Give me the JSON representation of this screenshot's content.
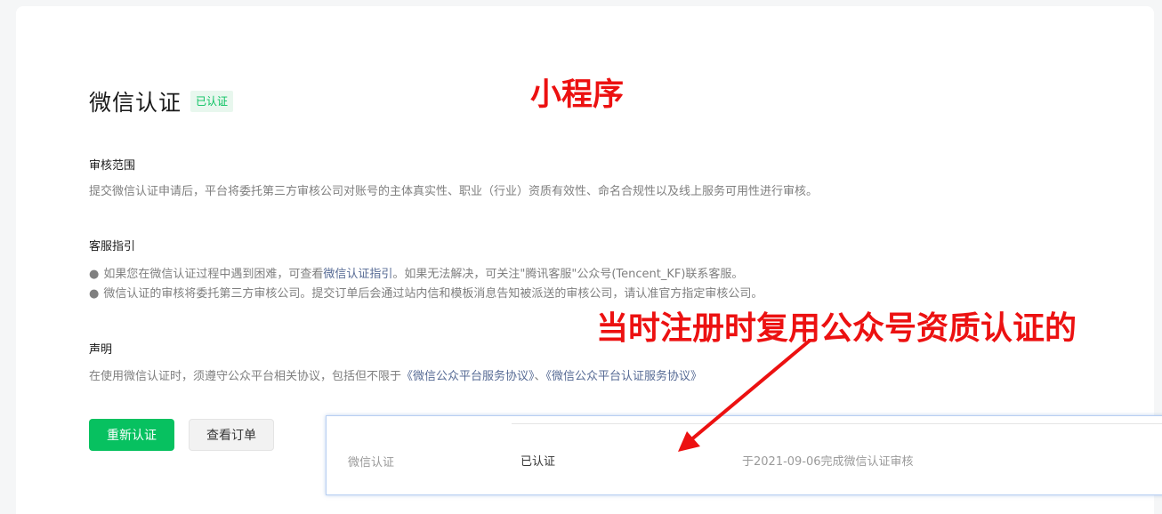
{
  "page": {
    "title": "微信认证",
    "status_badge": "已认证"
  },
  "annotations": {
    "top_label": "小程序",
    "note": "当时注册时复用公众号资质认证的",
    "color": "#ec1111"
  },
  "sections": {
    "scope": {
      "title": "审核范围",
      "text": "提交微信认证申请后，平台将委托第三方审核公司对账号的主体真实性、职业（行业）资质有效性、命名合规性以及线上服务可用性进行审核。"
    },
    "support": {
      "title": "客服指引",
      "line1_prefix": "如果您在微信认证过程中遇到困难，可查看",
      "line1_link": "微信认证指引",
      "line1_suffix": "。如果无法解决，可关注\"腾讯客服\"公众号(Tencent_KF)联系客服。",
      "line2": "微信认证的审核将委托第三方审核公司。提交订单后会通过站内信和模板消息告知被派送的审核公司，请认准官方指定审核公司。"
    },
    "statement": {
      "title": "声明",
      "text_prefix": "在使用微信认证时，须遵守公众平台相关协议，包括但不限于",
      "link1": "《微信公众平台服务协议》",
      "separator": "、",
      "link2": "《微信公众平台认证服务协议》"
    }
  },
  "buttons": {
    "reverify": "重新认证",
    "view_order": "查看订单"
  },
  "popup": {
    "label": "微信认证",
    "status": "已认证",
    "detail": "于2021-09-06完成微信认证审核"
  },
  "colors": {
    "primary": "#07c160",
    "link": "#576b95",
    "badge_bg": "#e8f7ee"
  }
}
